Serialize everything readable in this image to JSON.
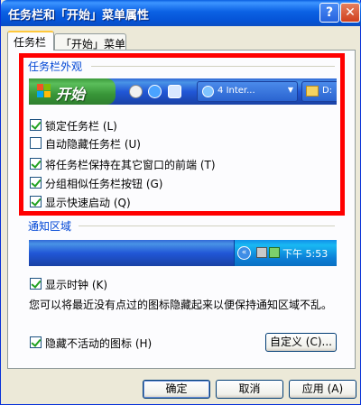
{
  "window": {
    "title": "任务栏和「开始」菜单属性",
    "help_glyph": "?",
    "close_glyph": "✕"
  },
  "tabs": [
    {
      "label": "任务栏",
      "active": true
    },
    {
      "label": "「开始」菜单",
      "active": false
    }
  ],
  "appearance": {
    "group_title": "任务栏外观",
    "taskbar_preview": {
      "start_label": "开始",
      "ie_task": "Inter...",
      "ie_badge": "4",
      "folder_task": "D:",
      "quick_launch_icons": [
        "media-player-icon",
        "ie-icon",
        "ie-alt-icon"
      ]
    },
    "options": [
      {
        "label": "锁定任务栏 (L)",
        "checked": true
      },
      {
        "label": "自动隐藏任务栏 (U)",
        "checked": false
      },
      {
        "label": "将任务栏保持在其它窗口的前端 (T)",
        "checked": true
      },
      {
        "label": "分组相似任务栏按钮 (G)",
        "checked": true
      },
      {
        "label": "显示快速启动 (Q)",
        "checked": true
      }
    ]
  },
  "notification": {
    "group_title": "通知区域",
    "tray_chevron": "«",
    "clock_text": "下午 5:53",
    "show_clock": {
      "label": "显示时钟 (K)",
      "checked": true
    },
    "description": "您可以将最近没有点过的图标隐藏起来以便保持通知区域不乱。",
    "hide_inactive": {
      "label": "隐藏不活动的图标 (H)",
      "checked": true
    },
    "customize_label": "自定义 (C)..."
  },
  "buttons": {
    "ok": "确定",
    "cancel": "取消",
    "apply": "应用 (A)"
  },
  "colors": {
    "highlight_border": "#ff0000",
    "title_bar": "#0553d6",
    "group_title": "#0046d5"
  }
}
